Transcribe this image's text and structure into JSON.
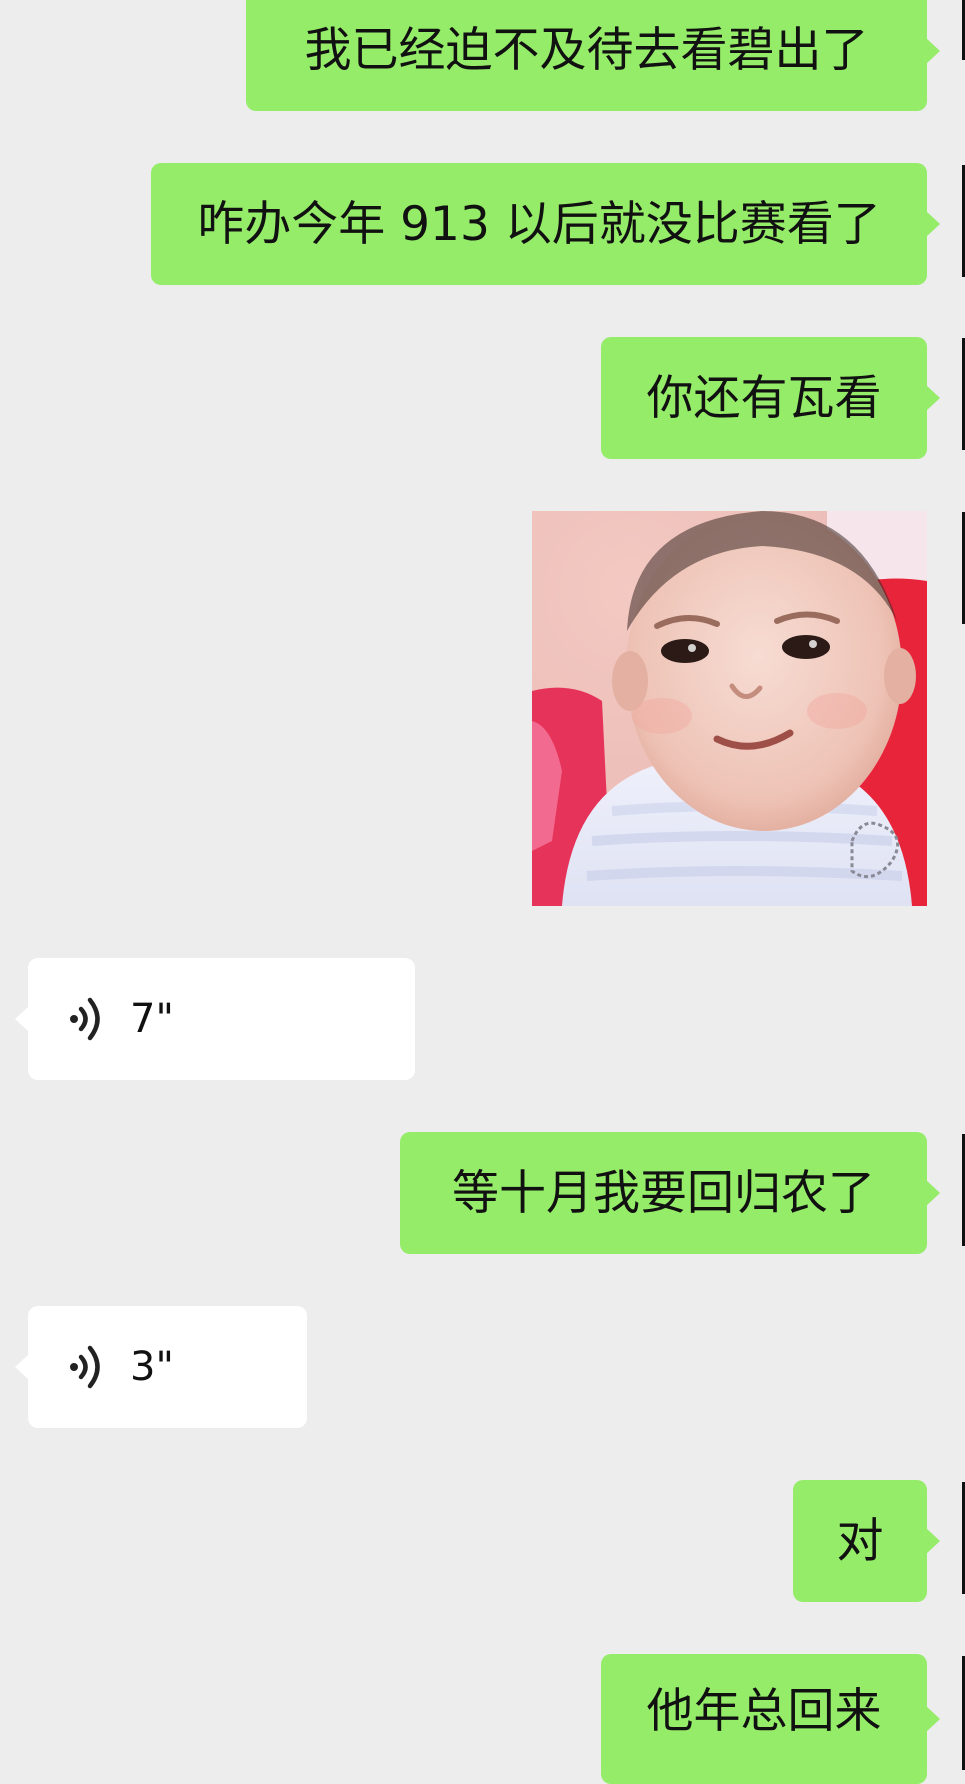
{
  "messages": [
    {
      "dir": "out",
      "type": "text",
      "text": "我已经迫不及待去看碧出了"
    },
    {
      "dir": "out",
      "type": "text",
      "text": "咋办今年 913 以后就没比赛看了"
    },
    {
      "dir": "out",
      "type": "text",
      "text": "你还有瓦看"
    },
    {
      "dir": "out",
      "type": "image",
      "image": "baby-sticker"
    },
    {
      "dir": "in",
      "type": "voice",
      "icon": "voice-wave-icon",
      "duration": "7\""
    },
    {
      "dir": "out",
      "type": "text",
      "text": "等十月我要回归农了"
    },
    {
      "dir": "in",
      "type": "voice",
      "icon": "voice-wave-icon",
      "duration": "3\""
    },
    {
      "dir": "out",
      "type": "text",
      "text": "对"
    },
    {
      "dir": "out",
      "type": "text",
      "text": "他年总回来"
    }
  ],
  "colors": {
    "background": "#ededed",
    "outgoing_bubble": "#95ec69",
    "incoming_bubble": "#ffffff",
    "text": "#111111"
  }
}
